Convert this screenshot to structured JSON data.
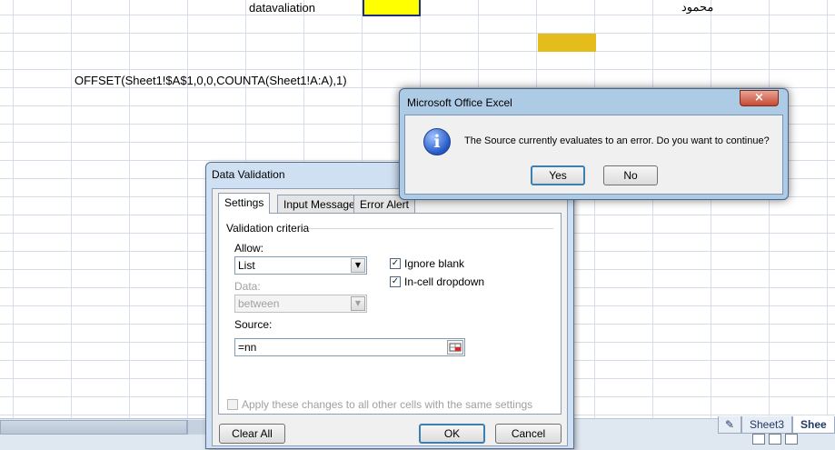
{
  "sheet": {
    "cell_text_1": "datavaliation",
    "cell_text_arabic": "محمود",
    "formula_text": "OFFSET(Sheet1!$A$1,0,0,COUNTA(Sheet1!A:A),1)",
    "tabs": [
      "Sheet3",
      "Shee"
    ],
    "colors": {
      "yellow": "#ffff00",
      "gold": "#e4bd1c",
      "grid": "#d4dde8"
    }
  },
  "data_validation": {
    "title": "Data Validation",
    "tabs": [
      "Settings",
      "Input Message",
      "Error Alert"
    ],
    "group_label": "Validation criteria",
    "allow_label": "Allow:",
    "allow_value": "List",
    "data_label": "Data:",
    "data_value": "between",
    "ignore_blank_label": "Ignore blank",
    "in_cell_dropdown_label": "In-cell dropdown",
    "source_label": "Source:",
    "source_value": "=nn",
    "apply_all_label": "Apply these changes to all other cells with the same settings",
    "clear_all_label": "Clear All",
    "ok_label": "OK",
    "cancel_label": "Cancel"
  },
  "message_box": {
    "title": "Microsoft Office Excel",
    "message": "The Source currently evaluates to an error. Do you want to continue?",
    "yes_label": "Yes",
    "no_label": "No",
    "close_glyph": "×",
    "icon": "info-icon"
  }
}
